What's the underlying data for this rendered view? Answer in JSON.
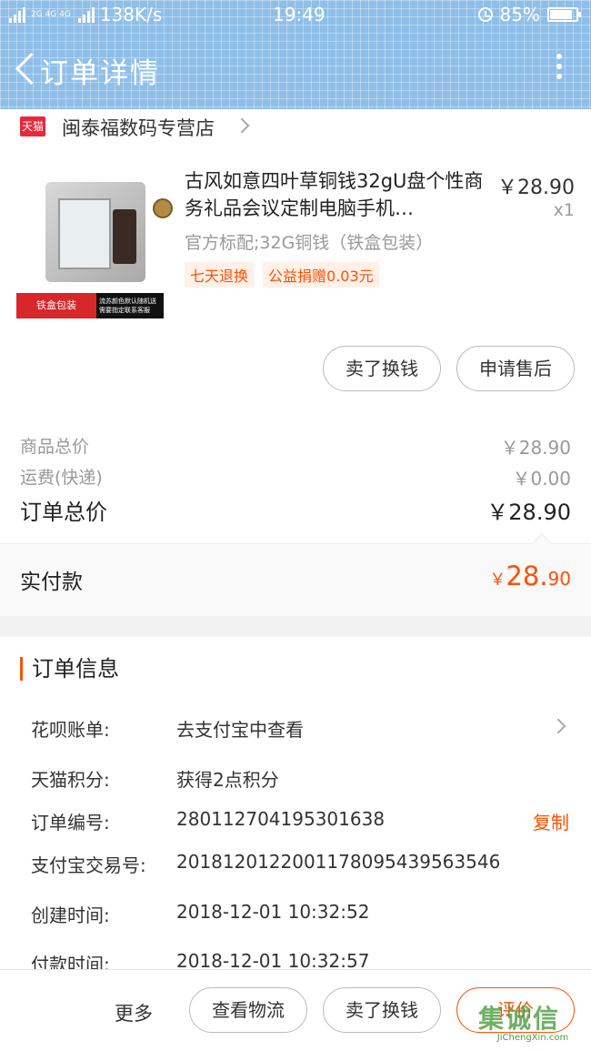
{
  "status_bar": {
    "network": "2G 4G 4G",
    "speed": "138K/s",
    "time": "19:49",
    "battery": "85%",
    "battery_level": 0.85
  },
  "nav": {
    "title": "订单详情"
  },
  "store": {
    "badge": "天猫",
    "name": "闽泰福数码专营店"
  },
  "product": {
    "title": "古风如意四叶草铜钱32gU盘个性商务礼品会议定制电脑手机…",
    "price": "￥28.90",
    "quantity": "x1",
    "spec": "官方标配;32G铜钱（铁盒包装）",
    "tags": [
      "七天退换",
      "公益捐赠0.03元"
    ],
    "image_band_left": "铁盒包装",
    "image_band_right": "流苏颜色默认随机送 需要指定联系客服"
  },
  "actions": {
    "sell": "卖了换钱",
    "after_sale": "申请售后"
  },
  "summary": {
    "goods_label": "商品总价",
    "goods_value": "￥28.90",
    "shipping_label": "运费(快递)",
    "shipping_value": "￥0.00",
    "total_label": "订单总价",
    "total_value": "￥28.90"
  },
  "paid": {
    "label": "实付款",
    "currency": "￥",
    "int": "28.",
    "dec": "90"
  },
  "order_info": {
    "title": "订单信息",
    "rows": [
      {
        "label": "花呗账单:",
        "value": "去支付宝中查看"
      },
      {
        "label": "天猫积分:",
        "value": "获得2点积分"
      },
      {
        "label": "订单编号:",
        "value": "280112704195301638"
      },
      {
        "label": "支付宝交易号:",
        "value": "2018120122001178095439563546"
      },
      {
        "label": "创建时间:",
        "value": "2018-12-01 10:32:52"
      },
      {
        "label": "付款时间:",
        "value": "2018-12-01 10:32:57"
      }
    ],
    "copy": "复制"
  },
  "footer": {
    "more": "更多",
    "logistics": "查看物流",
    "sell": "卖了换钱",
    "review": "评价"
  },
  "watermark": {
    "text": "集诚信",
    "url": "JiChengXin.com"
  },
  "colors": {
    "accent": "#ff5000",
    "header": "#8fbfe8"
  }
}
